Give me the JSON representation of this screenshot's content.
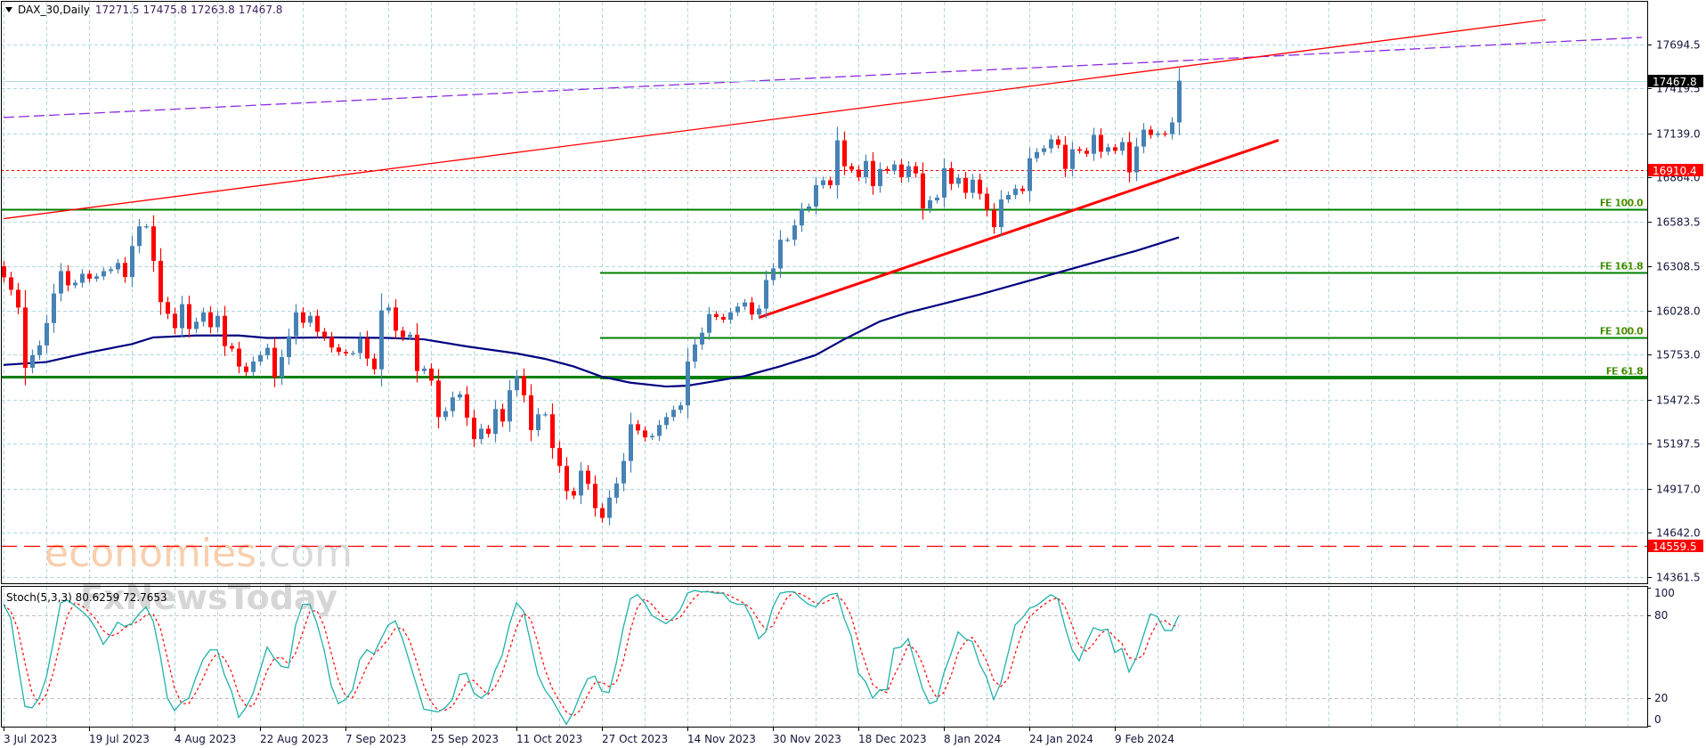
{
  "header": {
    "collapse_icon": "triangle-down-icon",
    "symbol_timeframe": "DAX_30,Daily",
    "open": "17271.5",
    "high": "17475.8",
    "low": "17263.8",
    "close": "17467.8"
  },
  "watermark": {
    "brand_part1": "economies",
    "brand_part2": ".com",
    "brand2": "FxNewsToday"
  },
  "colors": {
    "bull": "#4682b4",
    "bear": "#ff0000",
    "moving_average": "#000080",
    "fe_lines": "#008000",
    "trend": "#ff0000",
    "long_ma": "#8a2be2",
    "stoch_main": "#20b2aa",
    "stoch_signal": "#ff0000",
    "grid": "#b0d8dc",
    "bid_line": "#b4dcdc"
  },
  "chart_data": [
    {
      "type": "candlestick",
      "title": "DAX_30,Daily",
      "x_labels": [
        {
          "bar": 0,
          "label": "3 Jul 2023"
        },
        {
          "bar": 12,
          "label": "19 Jul 2023"
        },
        {
          "bar": 24,
          "label": "4 Aug 2023"
        },
        {
          "bar": 36,
          "label": "22 Aug 2023"
        },
        {
          "bar": 48,
          "label": "7 Sep 2023"
        },
        {
          "bar": 60,
          "label": "25 Sep 2023"
        },
        {
          "bar": 72,
          "label": "11 Oct 2023"
        },
        {
          "bar": 84,
          "label": "27 Oct 2023"
        },
        {
          "bar": 96,
          "label": "14 Nov 2023"
        },
        {
          "bar": 108,
          "label": "30 Nov 2023"
        },
        {
          "bar": 120,
          "label": "18 Dec 2023"
        },
        {
          "bar": 132,
          "label": "8 Jan 2024"
        },
        {
          "bar": 144,
          "label": "24 Jan 2024"
        },
        {
          "bar": 156,
          "label": "9 Feb 2024"
        }
      ],
      "y_ticks": [
        "17694.5",
        "17419.5",
        "17139.0",
        "16864.0",
        "16583.5",
        "16308.5",
        "16028.0",
        "15753.0",
        "15472.5",
        "15197.5",
        "14917.0",
        "14642.0",
        "14361.5"
      ],
      "grid": true,
      "first_open": 16307,
      "close": [
        16238,
        16160,
        16049,
        15672,
        15751,
        15812,
        15952,
        16137,
        16277,
        16188,
        16204,
        16260,
        16229,
        16244,
        16277,
        16288,
        16328,
        16240,
        16434,
        16557,
        16557,
        16341,
        16083,
        16010,
        15920,
        16070,
        15915,
        15960,
        16019,
        15926,
        15997,
        15808,
        15792,
        15680,
        15646,
        15711,
        15751,
        15797,
        15612,
        15739,
        15870,
        16019,
        15954,
        15997,
        15898,
        15864,
        15799,
        15771,
        15762,
        15764,
        15857,
        15730,
        15663,
        16031,
        16049,
        15904,
        15864,
        15879,
        15652,
        15667,
        15592,
        15364,
        15401,
        15487,
        15506,
        15360,
        15226,
        15291,
        15259,
        15414,
        15336,
        15532,
        15622,
        15500,
        15282,
        15381,
        15381,
        15170,
        15058,
        14901,
        14873,
        15028,
        14946,
        14794,
        14733,
        14860,
        14949,
        15089,
        15319,
        15280,
        15237,
        15246,
        15314,
        15364,
        15409,
        15437,
        15711,
        15818,
        15891,
        16008,
        15990,
        15973,
        16019,
        16055,
        16081,
        16005,
        16042,
        16221,
        16294,
        16473,
        16473,
        16563,
        16664,
        16681,
        16815,
        16845,
        16815,
        17095,
        16933,
        16912,
        16865,
        16966,
        16809,
        16916,
        16905,
        16944,
        16865,
        16933,
        16888,
        16669,
        16720,
        16737,
        16921,
        16823,
        16860,
        16767,
        16849,
        16761,
        16660,
        16552,
        16725,
        16753,
        16793,
        16778,
        16983,
        17022,
        17045,
        17101,
        17067,
        16916,
        17039,
        17030,
        17011,
        17129,
        17024,
        17052,
        17030,
        17084,
        16895,
        17056,
        17162,
        17129,
        17138,
        17134,
        17207,
        17467.8
      ],
      "moving_average": [
        [
          0,
          15690
        ],
        [
          6,
          15708
        ],
        [
          12,
          15768
        ],
        [
          18,
          15820
        ],
        [
          21,
          15862
        ],
        [
          27,
          15874
        ],
        [
          33,
          15874
        ],
        [
          37,
          15859
        ],
        [
          46,
          15862
        ],
        [
          54,
          15859
        ],
        [
          59,
          15850
        ],
        [
          65,
          15806
        ],
        [
          72,
          15762
        ],
        [
          76,
          15728
        ],
        [
          80,
          15681
        ],
        [
          84,
          15616
        ],
        [
          88,
          15579
        ],
        [
          93,
          15555
        ],
        [
          96,
          15560
        ],
        [
          99,
          15582
        ],
        [
          104,
          15620
        ],
        [
          109,
          15681
        ],
        [
          114,
          15751
        ],
        [
          118,
          15850
        ],
        [
          123,
          15962
        ],
        [
          127,
          16018
        ],
        [
          132,
          16074
        ],
        [
          137,
          16130
        ],
        [
          159,
          16404
        ],
        [
          165,
          16488
        ]
      ],
      "long_ma": [
        [
          0,
          17238
        ],
        [
          125,
          17509
        ],
        [
          159,
          17579
        ],
        [
          230,
          17739
        ]
      ],
      "trendlines": [
        {
          "name": "channel-trendline",
          "from": [
            0,
            16605
          ],
          "to": [
            216.5,
            17850
          ],
          "width": "thin"
        },
        {
          "name": "support-trendline",
          "from": [
            106,
            15986
          ],
          "to": [
            179,
            17096
          ],
          "width": "thick"
        }
      ],
      "levels": [
        {
          "label": "FE 100.0",
          "price": 16664,
          "from_bar": 0,
          "style": "solid"
        },
        {
          "label": "FE 161.8",
          "price": 16270,
          "from_bar": 84,
          "style": "solid"
        },
        {
          "label": "FE 100.0",
          "price": 15863,
          "from_bar": 84,
          "style": "solid"
        },
        {
          "label": "",
          "price": 15617,
          "from_bar": 0,
          "style": "thick"
        },
        {
          "label": "FE 61.8",
          "price": 15612,
          "from_bar": 84,
          "style": "thick"
        }
      ],
      "price_markers": [
        {
          "label": "17467.8",
          "price": 17467.8,
          "kind": "bid",
          "box": "#000000"
        },
        {
          "label": "16910.4",
          "price": 16910.4,
          "kind": "dotted",
          "box": "#ff0000"
        },
        {
          "label": "14559.5",
          "price": 14559.5,
          "kind": "dashed",
          "box": "#ff0000"
        }
      ]
    },
    {
      "type": "line",
      "title": "Stoch(5,3,3) 80.6259 72.7653",
      "ylim": [
        0,
        100
      ],
      "y_ticks": [
        "100",
        "80",
        "20",
        "0"
      ],
      "levels": [
        80,
        20
      ],
      "series": [
        {
          "name": "main",
          "values": [
            88,
            78,
            45,
            14,
            13,
            20,
            35,
            61,
            89,
            91,
            87,
            83,
            78,
            70,
            59,
            66,
            75,
            72,
            74,
            81,
            86,
            76,
            51,
            20,
            11,
            17,
            20,
            35,
            48,
            55,
            55,
            37,
            25,
            6,
            13,
            23,
            40,
            57,
            49,
            43,
            42,
            73,
            88,
            88,
            74,
            55,
            29,
            16,
            19,
            26,
            48,
            55,
            52,
            63,
            73,
            76,
            63,
            46,
            29,
            12,
            11,
            10,
            13,
            19,
            37,
            38,
            24,
            20,
            24,
            40,
            51,
            73,
            89,
            83,
            60,
            37,
            26,
            19,
            10,
            1,
            10,
            23,
            34,
            36,
            25,
            24,
            45,
            71,
            92,
            95,
            89,
            80,
            77,
            74,
            78,
            84,
            96,
            98,
            97,
            97,
            96,
            96,
            90,
            88,
            88,
            78,
            63,
            68,
            86,
            96,
            97,
            97,
            92,
            88,
            86,
            92,
            95,
            96,
            78,
            65,
            38,
            32,
            20,
            26,
            26,
            56,
            57,
            63,
            45,
            27,
            16,
            18,
            38,
            52,
            68,
            63,
            61,
            45,
            35,
            19,
            31,
            52,
            73,
            78,
            85,
            87,
            91,
            95,
            92,
            72,
            55,
            47,
            60,
            71,
            69,
            70,
            53,
            56,
            39,
            49,
            65,
            81,
            79,
            69,
            69,
            80
          ]
        }
      ]
    }
  ]
}
